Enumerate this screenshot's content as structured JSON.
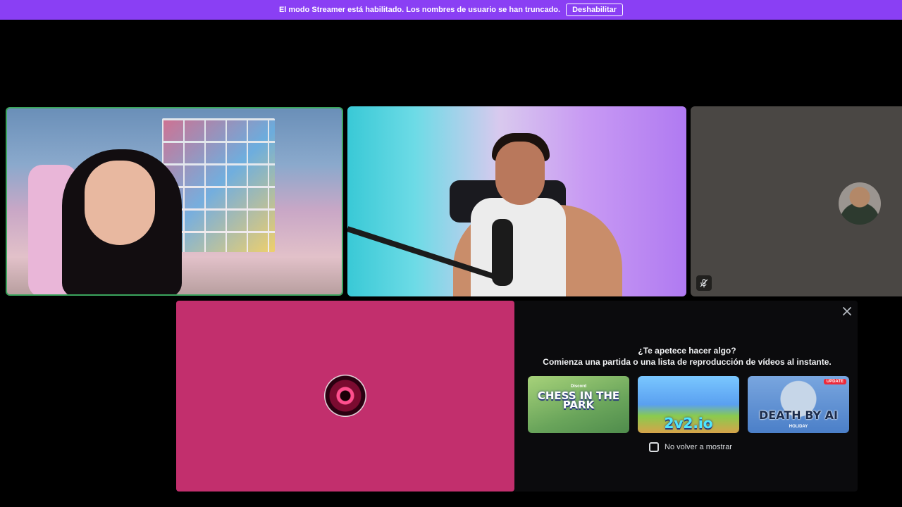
{
  "banner": {
    "message": "El modo Streamer está habilitado. Los nombres de usuario se han truncado.",
    "button_label": "Deshabilitar",
    "color": "#8a3ff4"
  },
  "tiles": [
    {
      "name": "participant-1",
      "speaking": true,
      "speaking_color": "#3ba55d"
    },
    {
      "name": "participant-2",
      "speaking": false
    },
    {
      "name": "participant-3",
      "camera": "off",
      "muted_icon": "mic-muted-icon"
    }
  ],
  "activity": {
    "prompt_line1": "¿Te apetece hacer algo?",
    "prompt_line2": "Comienza una partida o una lista de reproducción de vídeos al instante.",
    "close_icon": "close-icon",
    "stage_color": "#c22f6d",
    "games": [
      {
        "title": "CHESS IN THE PARK",
        "top_label": "Discord"
      },
      {
        "title": "2v2.io"
      },
      {
        "title": "DEATH BY AI",
        "subtitle": "HOLIDAY",
        "badge": "UPDATE"
      }
    ],
    "checkbox_label": "No volver a mostrar",
    "checkbox_checked": false
  }
}
